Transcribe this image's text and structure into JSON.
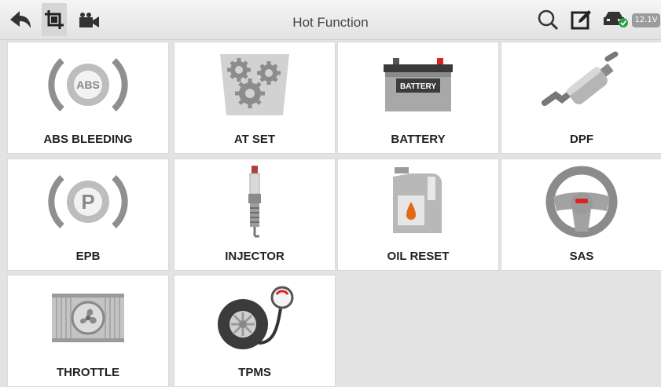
{
  "header": {
    "title": "Hot Function",
    "voltage": "12.1V",
    "icons": [
      "back-arrow-icon",
      "screenshot-crop-icon",
      "video-record-icon",
      "search-icon",
      "edit-note-icon",
      "vehicle-connected-icon"
    ]
  },
  "tiles": [
    {
      "label": "ABS BLEEDING",
      "icon": "abs-icon"
    },
    {
      "label": "AT SET",
      "icon": "gears-icon"
    },
    {
      "label": "BATTERY",
      "icon": "battery-icon",
      "badge": "BATTERY"
    },
    {
      "label": "DPF",
      "icon": "exhaust-filter-icon"
    },
    {
      "label": "EPB",
      "icon": "parking-brake-icon"
    },
    {
      "label": "INJECTOR",
      "icon": "spark-plug-icon"
    },
    {
      "label": "OIL RESET",
      "icon": "oil-can-icon"
    },
    {
      "label": "SAS",
      "icon": "steering-wheel-icon"
    },
    {
      "label": "THROTTLE",
      "icon": "radiator-fan-icon"
    },
    {
      "label": "TPMS",
      "icon": "tire-gauge-icon"
    }
  ]
}
